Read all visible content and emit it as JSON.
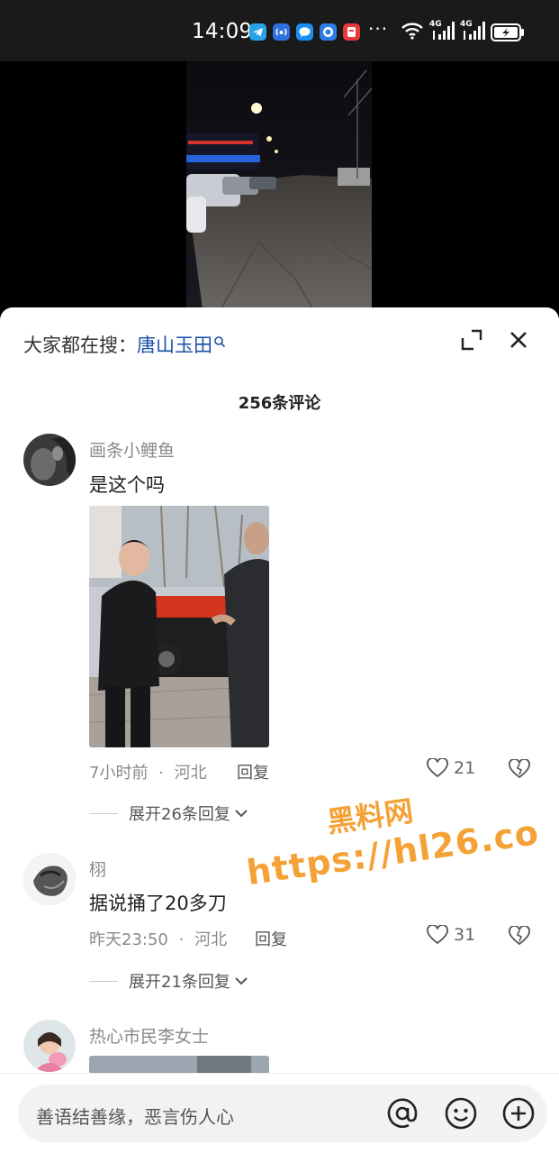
{
  "status_bar": {
    "time": "14:09",
    "overflow_dots": "···",
    "network_label": "4G"
  },
  "search_hint": {
    "prefix": "大家都在搜：",
    "query": "唐山玉田"
  },
  "comments_title": "256条评论",
  "comments": [
    {
      "username": "画条小鲤鱼",
      "text": "是这个吗",
      "time": "7小时前",
      "location": "河北",
      "reply_label": "回复",
      "likes": "21",
      "expand_label": "展开26条回复"
    },
    {
      "username": "栩",
      "text": "据说捅了20多刀",
      "time": "昨天23:50",
      "location": "河北",
      "reply_label": "回复",
      "likes": "31",
      "expand_label": "展开21条回复"
    },
    {
      "username": "热心市民李女士"
    }
  ],
  "meta_separator": "·",
  "watermark": {
    "title": "黑料网",
    "url": "https://hl26.co"
  },
  "input": {
    "placeholder": "善语结善缘，恶言伤人心"
  },
  "colors": {
    "link": "#1a4fa6",
    "watermark": "#f4a236",
    "sheet_bg": "#ffffff"
  }
}
